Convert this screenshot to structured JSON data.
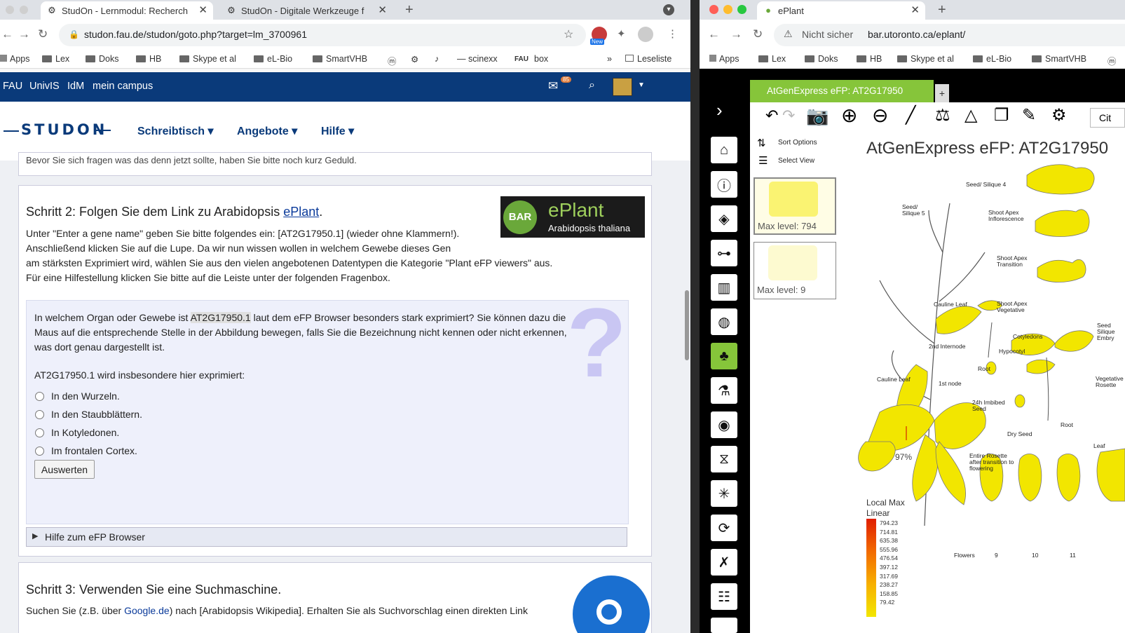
{
  "left": {
    "tabs": [
      {
        "title": "StudOn - Lernmodul: Recherch",
        "active": true
      },
      {
        "title": "StudOn - Digitale Werkzeuge f",
        "active": false
      }
    ],
    "url": "studon.fau.de/studon/goto.php?target=lm_3700961",
    "bookmarks": [
      "Apps",
      "Lex",
      "Doks",
      "HB",
      "Skype et al",
      "eL-Bio",
      "SmartVHB",
      "scinexx",
      "box",
      "»",
      "Leseliste"
    ],
    "ext_badge": "New",
    "fau_nav": [
      "FAU",
      "UnivIS",
      "IdM",
      "mein campus"
    ],
    "mail_count": "85",
    "logo_text": "STUDON",
    "menu": [
      "Schreibtisch",
      "Angebote",
      "Hilfe"
    ],
    "cut_text": "Bevor Sie sich fragen was das denn jetzt sollte, haben Sie bitte noch kurz Geduld.",
    "step2": {
      "heading_pre": "Schritt 2: Folgen Sie dem Link zu Arabidopsis ",
      "heading_link": "ePlant",
      "heading_post": ".",
      "lines": [
        "Unter \"Enter a gene name\" geben Sie bitte folgendes ein: [AT2G17950.1] (wieder ohne Klammern!).",
        "Anschließend klicken Sie auf die Lupe. Da wir nun wissen wollen in welchem Gewebe dieses Gen",
        "am stärksten Exprimiert wird, wählen Sie aus den vielen angebotenen Datentypen die Kategorie \"Plant eFP viewers\" aus.",
        "Für eine Hilfestellung klicken Sie bitte auf die Leiste unter der folgenden Fragenbox."
      ],
      "banner": {
        "bar": "BAR",
        "title": "ePlant",
        "subtitle": "Arabidopsis thaliana"
      }
    },
    "question": {
      "q1_pre": "In welchem Organ oder Gewebe ist ",
      "q1_code": "AT2G17950.1",
      "q1_post": " laut dem eFP Browser besonders stark exprimiert? Sie können dazu die",
      "q2": "Maus auf die entsprechende Stelle in der Abbildung bewegen, falls Sie die Bezeichnung nicht kennen oder nicht erkennen,",
      "q3": "was dort genau dargestellt ist.",
      "prompt": "AT2G17950.1 wird insbesondere hier exprimiert:",
      "options": [
        "In den Wurzeln.",
        "In den Staubblättern.",
        "In Kotyledonen.",
        "Im frontalen Cortex."
      ],
      "button": "Auswerten",
      "qmark": "?"
    },
    "help_bar": "Hilfe zum eFP Browser",
    "step3": {
      "heading": "Schritt 3: Verwenden Sie eine Suchmaschine.",
      "line_pre": "Suchen Sie (z.B. über ",
      "line_link": "Google.de",
      "line_post": ") nach [Arabidopsis Wikipedia]. Erhalten Sie als Suchvorschlag einen direkten Link"
    }
  },
  "right": {
    "tab_title": "ePlant",
    "insecure": "Nicht sicher",
    "url": "bar.utoronto.ca/eplant/",
    "bookmarks": [
      "Apps",
      "Lex",
      "Doks",
      "HB",
      "Skype et al",
      "eL-Bio",
      "SmartVHB"
    ],
    "view_tab": "AtGenExpress eFP: AT2G17950",
    "sort_options": "Sort Options",
    "select_view": "Select View",
    "thumb1": "Max level: 794",
    "thumb2": "Max level: 9",
    "cite": "Cit",
    "efp_title": "AtGenExpress eFP: AT2G17950",
    "labels": {
      "seed_silique4": "Seed/ Silique 4",
      "seed_silique5": "Seed/ Silique 5",
      "sa_infl": "Shoot Apex Inflorescence",
      "sa_trans": "Shoot Apex Transition",
      "sa_veg": "Shoot Apex Vegetative",
      "cauline_leaf1": "Cauline Leaf",
      "cauline_leaf2": "Cauline Leaf",
      "internode2": "2nd Internode",
      "node1": "1st node",
      "cotyledons": "Cotyledons",
      "hypocotyl": "Hypocotyl",
      "root1": "Root",
      "root2": "Root",
      "imbibed": "24h Imbibed Seed",
      "dry_seed": "Dry Seed",
      "veg_rosette": "Vegetative Rosette",
      "seed_silique_embryo": "Seed Silique Embry",
      "leaf": "Leaf",
      "entire_rosette": "Entire Rosette after transition to flowering",
      "pct": "97%",
      "flowers": "Flowers",
      "f9": "9",
      "f10": "10",
      "f11": "11"
    },
    "legend": {
      "title": "Local Max",
      "mode": "Linear",
      "values": [
        "794.23",
        "714.81",
        "635.38",
        "555.96",
        "476.54",
        "397.12",
        "317.69",
        "238.27",
        "158.85",
        "79.42"
      ]
    }
  }
}
